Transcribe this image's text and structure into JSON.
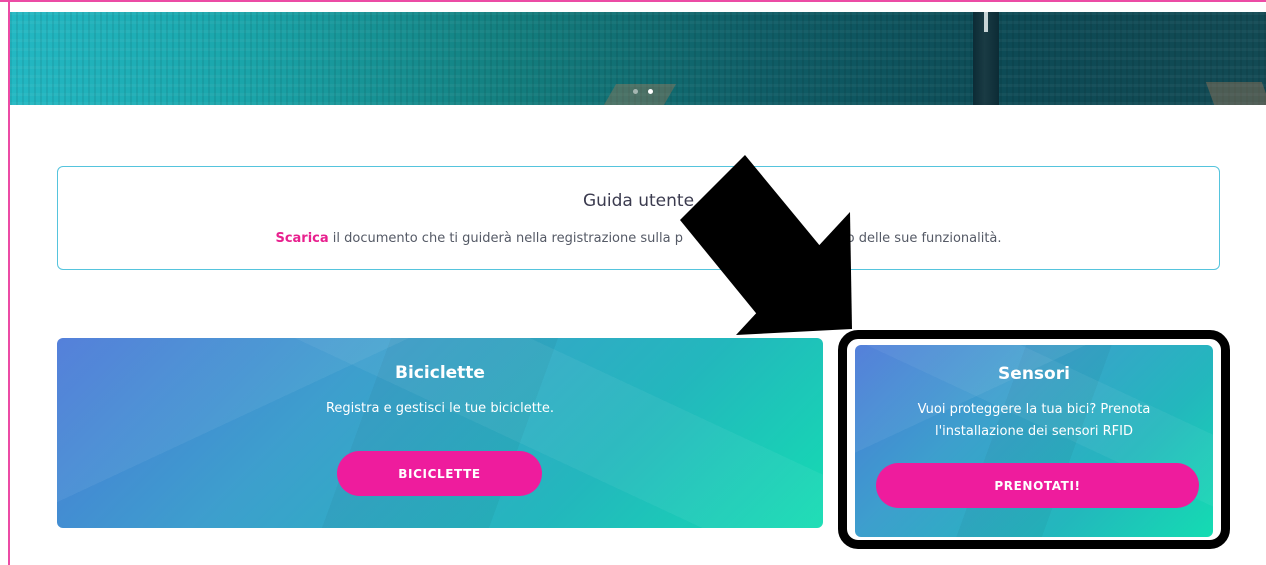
{
  "hero": {
    "slides": [
      {
        "active": false
      },
      {
        "active": true
      }
    ]
  },
  "guide": {
    "title": "Guida utente",
    "link_text": "Scarica",
    "text_before_arrow": " il documento che ti guiderà nella registrazione sulla p",
    "text_after_arrow": "zzo delle sue funzionalità."
  },
  "cards": {
    "biciclette": {
      "title": "Biciclette",
      "description": "Registra e gestisci le tue biciclette.",
      "button": "BICICLETTE"
    },
    "sensori": {
      "title": "Sensori",
      "description": "Vuoi proteggere la tua bici? Prenota l'installazione dei sensori RFID",
      "button": "PRENOTATI!"
    }
  },
  "colors": {
    "accent": "#ee1c9d",
    "card_gradient_start": "#4a78d8",
    "card_gradient_end": "#14dcb2",
    "guide_border": "#55c4dd"
  },
  "annotations": {
    "arrow_color": "#000000",
    "highlight_target": "sensori"
  }
}
